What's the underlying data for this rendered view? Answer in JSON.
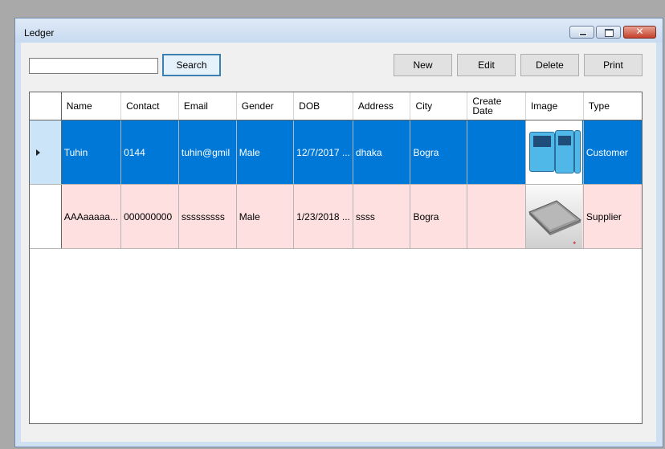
{
  "window": {
    "title": "Ledger"
  },
  "toolbar": {
    "search_value": "",
    "search_label": "Search",
    "new_label": "New",
    "edit_label": "Edit",
    "delete_label": "Delete",
    "print_label": "Print"
  },
  "grid": {
    "columns": [
      "Name",
      "Contact",
      "Email",
      "Gender",
      "DOB",
      "Address",
      "City",
      "Create Date",
      "Image",
      "Type"
    ],
    "rows": [
      {
        "name": "Tuhin",
        "contact": "0144",
        "email": "tuhin@gmil",
        "gender": "Male",
        "dob": "12/7/2017 ...",
        "address": "dhaka",
        "city": "Bogra",
        "create_date": "",
        "image": "phone-image",
        "type": "Customer",
        "selected": true
      },
      {
        "name": "AAAaaaaa...",
        "contact": "000000000",
        "email": "sssssssss",
        "gender": "Male",
        "dob": "1/23/2018 ...",
        "address": "ssss",
        "city": "Bogra",
        "create_date": "",
        "image": "laptop-image",
        "type": "Supplier",
        "selected": false
      }
    ]
  },
  "colors": {
    "selection": "#0078d7",
    "row_alt": "#ffe0e0",
    "header_selected": "#cce4f7"
  }
}
